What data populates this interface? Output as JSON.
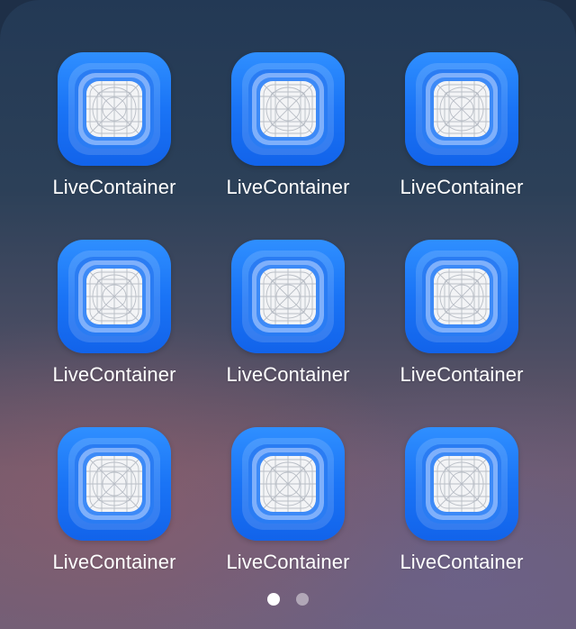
{
  "folder": {
    "apps": [
      {
        "label": "LiveContainer",
        "icon": "livecontainer-app-icon"
      },
      {
        "label": "LiveContainer",
        "icon": "livecontainer-app-icon"
      },
      {
        "label": "LiveContainer",
        "icon": "livecontainer-app-icon"
      },
      {
        "label": "LiveContainer",
        "icon": "livecontainer-app-icon"
      },
      {
        "label": "LiveContainer",
        "icon": "livecontainer-app-icon"
      },
      {
        "label": "LiveContainer",
        "icon": "livecontainer-app-icon"
      },
      {
        "label": "LiveContainer",
        "icon": "livecontainer-app-icon"
      },
      {
        "label": "LiveContainer",
        "icon": "livecontainer-app-icon"
      },
      {
        "label": "LiveContainer",
        "icon": "livecontainer-app-icon"
      }
    ],
    "page_indicator": {
      "pages": 2,
      "current_page": 1
    }
  },
  "colors": {
    "icon_blue": "#1a74f6",
    "label": "#ffffff",
    "active_dot": "#ffffff"
  }
}
